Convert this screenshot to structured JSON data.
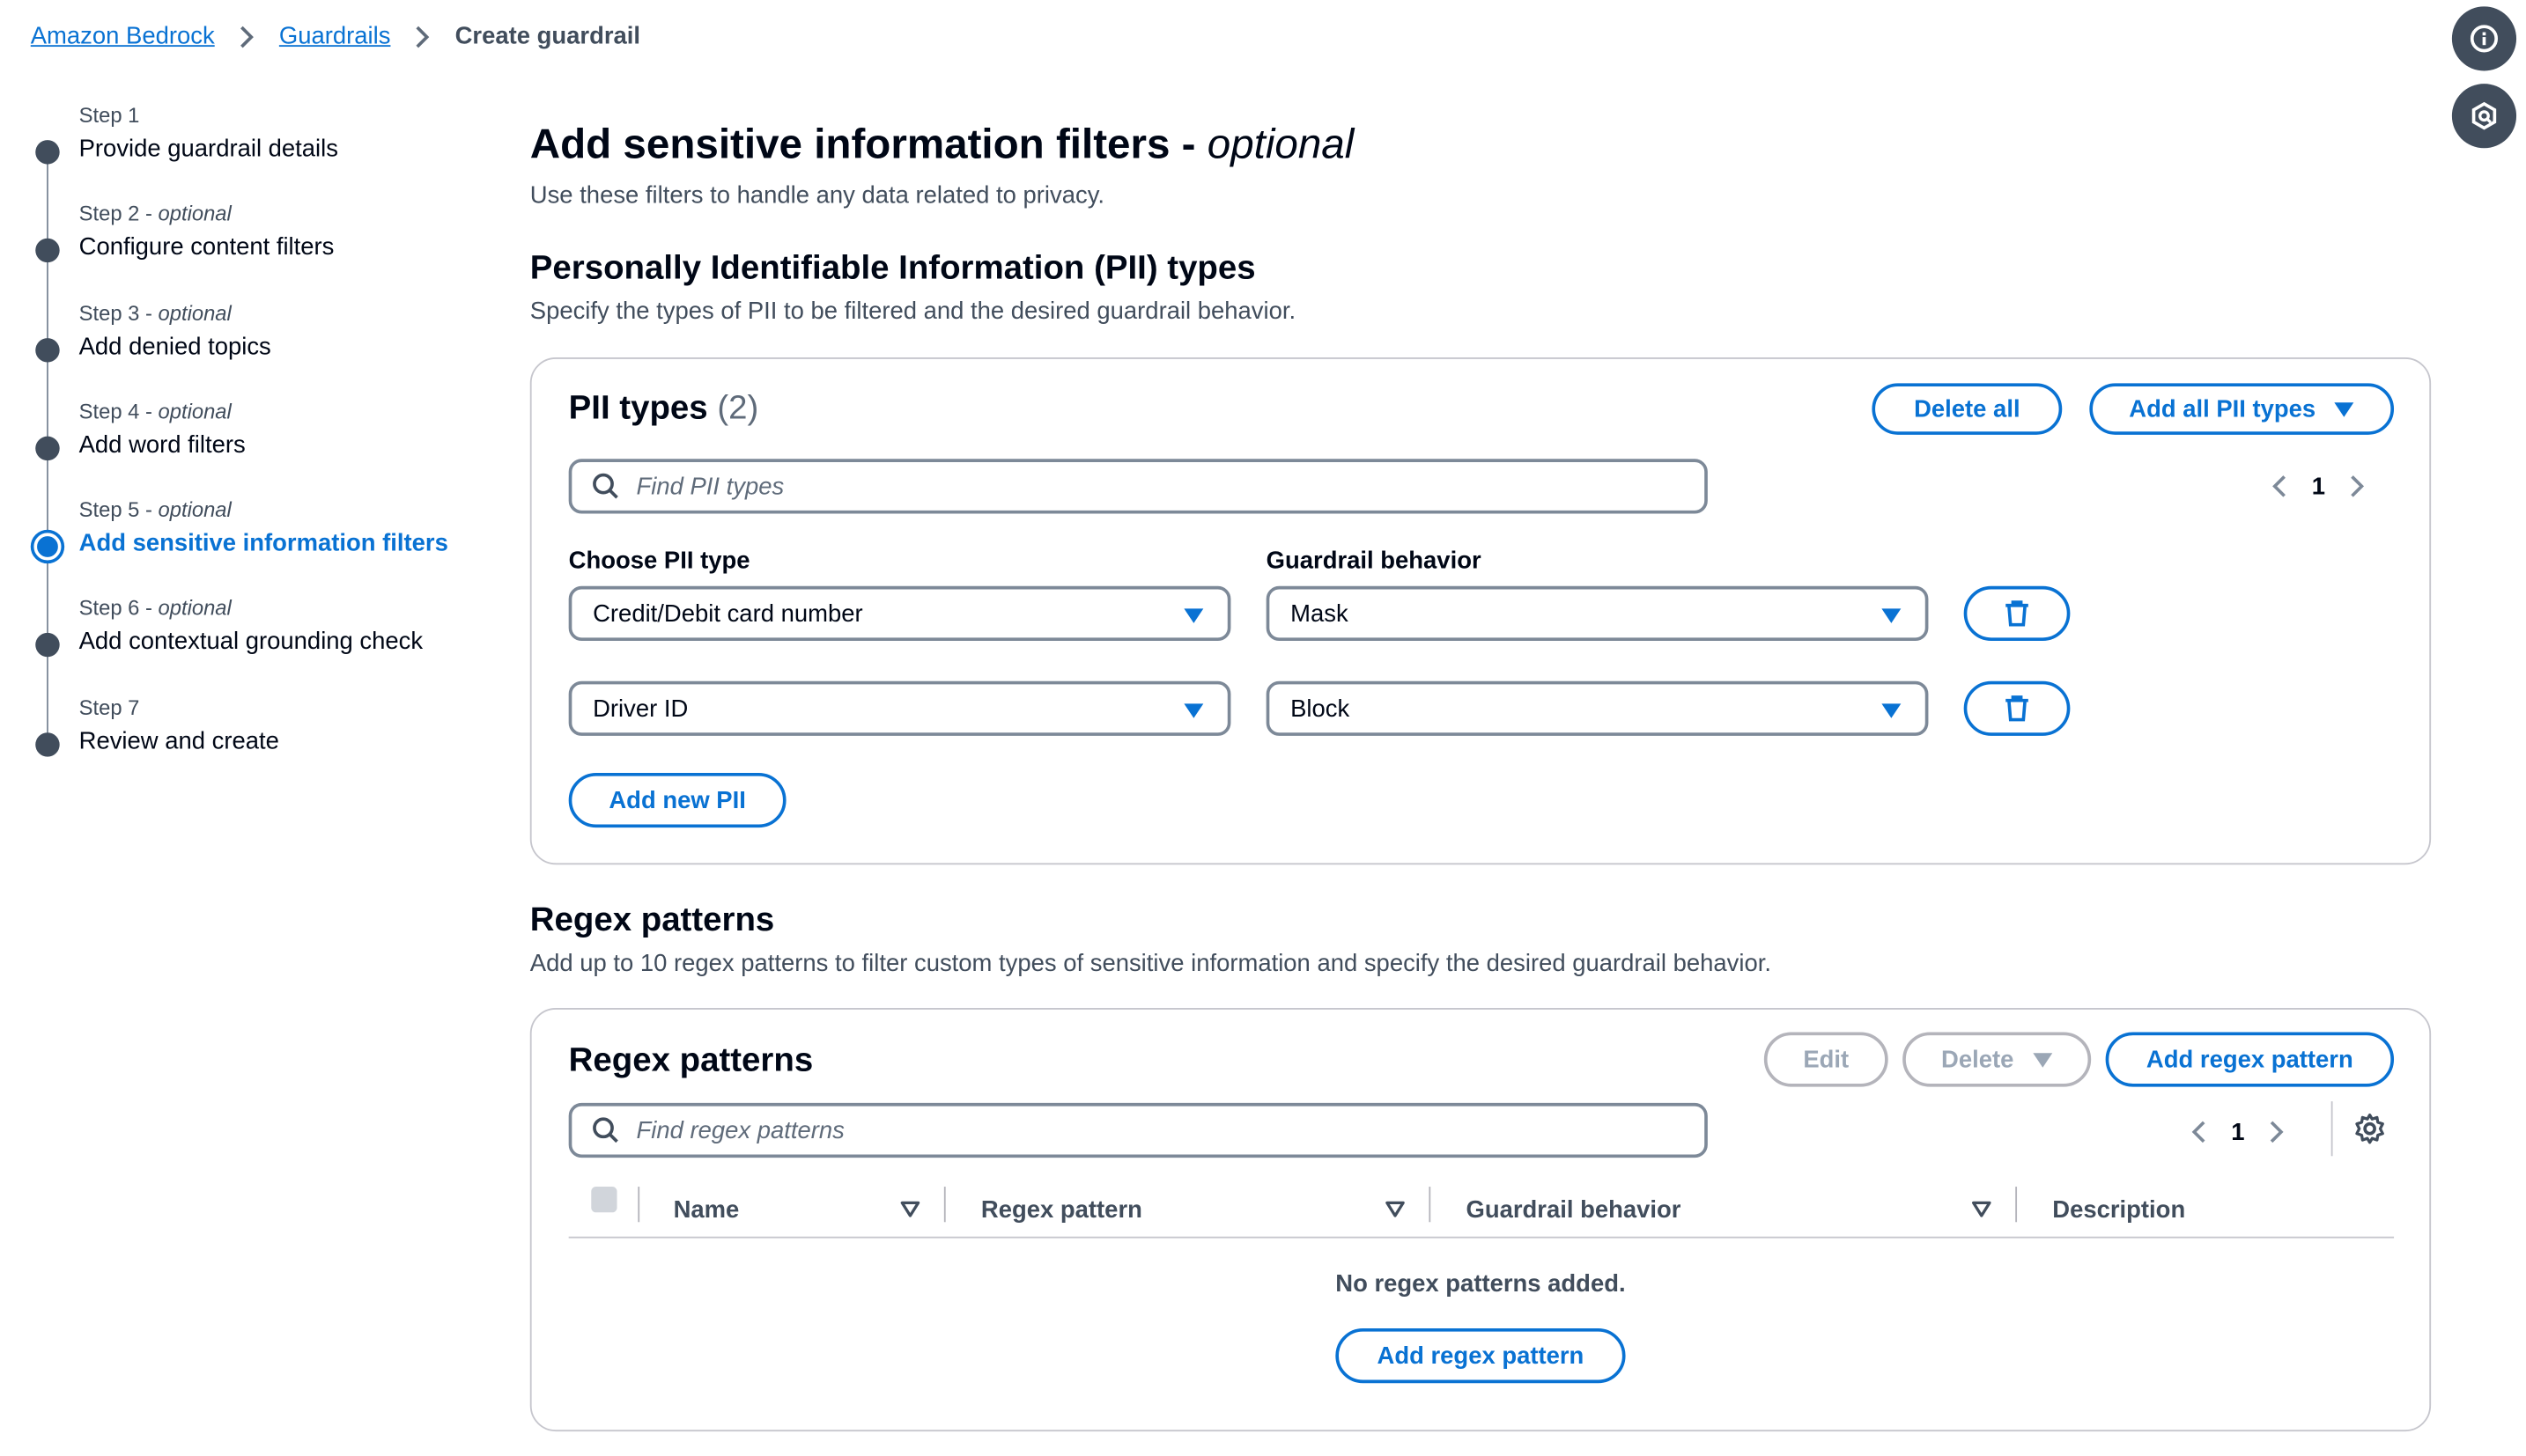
{
  "breadcrumb": {
    "items": [
      "Amazon Bedrock",
      "Guardrails"
    ],
    "current": "Create guardrail"
  },
  "floating_icons": [
    "info-icon",
    "feedback-icon"
  ],
  "steps": [
    {
      "num": "Step 1",
      "optional": "",
      "title": "Provide guardrail details"
    },
    {
      "num": "Step 2 - ",
      "optional": "optional",
      "title": "Configure content filters"
    },
    {
      "num": "Step 3 - ",
      "optional": "optional",
      "title": "Add denied topics"
    },
    {
      "num": "Step 4 - ",
      "optional": "optional",
      "title": "Add word filters"
    },
    {
      "num": "Step 5 - ",
      "optional": "optional",
      "title": "Add sensitive information filters"
    },
    {
      "num": "Step 6 - ",
      "optional": "optional",
      "title": "Add contextual grounding check"
    },
    {
      "num": "Step 7",
      "optional": "",
      "title": "Review and create"
    }
  ],
  "active_step": 5,
  "page": {
    "title": "Add sensitive information filters - ",
    "title_optional": "optional",
    "subtitle": "Use these filters to handle any data related to privacy."
  },
  "pii_section": {
    "heading": "Personally Identifiable Information (PII) types",
    "description": "Specify the types of PII to be filtered and the desired guardrail behavior.",
    "panel_title": "PII types",
    "count": "(2)",
    "delete_all_label": "Delete all",
    "add_all_label": "Add all PII types",
    "search_placeholder": "Find PII types",
    "page_number": "1",
    "col_type_label": "Choose PII type",
    "col_behavior_label": "Guardrail behavior",
    "rows": [
      {
        "type": "Credit/Debit card number",
        "behavior": "Mask"
      },
      {
        "type": "Driver ID",
        "behavior": "Block"
      }
    ],
    "add_new_label": "Add new PII"
  },
  "regex_section": {
    "heading": "Regex patterns",
    "description": "Add up to 10 regex patterns to filter custom types of sensitive information and specify the desired guardrail behavior.",
    "panel_title": "Regex patterns",
    "edit_label": "Edit",
    "delete_label": "Delete",
    "add_label": "Add regex pattern",
    "search_placeholder": "Find regex patterns",
    "page_number": "1",
    "columns": [
      "Name",
      "Regex pattern",
      "Guardrail behavior",
      "Description"
    ],
    "empty_text": "No regex patterns added.",
    "empty_add_label": "Add regex pattern"
  },
  "colors": {
    "accent": "#0972d3",
    "text": "#000716",
    "muted": "#414d5c",
    "border": "#7d8998"
  }
}
